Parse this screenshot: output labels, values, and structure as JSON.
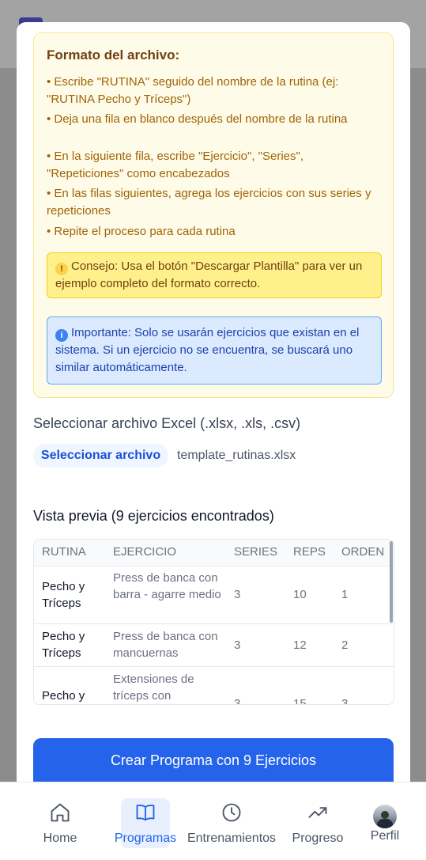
{
  "format": {
    "title": "Formato del archivo:",
    "bullets": [
      "• Escribe \"RUTINA\" seguido del nombre de la rutina (ej: \"RUTINA Pecho y Tríceps\")",
      "• Deja una fila en blanco después del nombre de la rutina",
      "• En la siguiente fila, escribe \"Ejercicio\", \"Series\", \"Repeticiones\" como encabezados",
      "• En las filas siguientes, agrega los ejercicios con sus series y repeticiones",
      "• Repite el proceso para cada rutina"
    ],
    "tip": "Consejo: Usa el botón \"Descargar Plantilla\" para ver un ejemplo completo del formato correcto.",
    "important": "Importante: Solo se usarán ejercicios que existan en el sistema. Si un ejercicio no se encuentra, se buscará uno similar automáticamente."
  },
  "file": {
    "label": "Seleccionar archivo Excel (.xlsx, .xls, .csv)",
    "button": "Seleccionar archivo",
    "filename": "template_rutinas.xlsx"
  },
  "preview": {
    "title": "Vista previa (9 ejercicios encontrados)",
    "columns": [
      "RUTINA",
      "EJERCICIO",
      "SERIES",
      "REPS",
      "ORDEN"
    ],
    "rows": [
      {
        "rutina": "Pecho y Tríceps",
        "ejercicio": "Press de banca con barra - agarre medio",
        "series": "3",
        "reps": "10",
        "orden": "1"
      },
      {
        "rutina": "Pecho y Tríceps",
        "ejercicio": "Press de banca con mancuernas",
        "series": "3",
        "reps": "12",
        "orden": "2"
      },
      {
        "rutina": "Pecho y",
        "ejercicio": "Extensiones de tríceps con",
        "series": "3",
        "reps": "15",
        "orden": "3"
      }
    ]
  },
  "create_button": "Crear Programa con 9 Ejercicios",
  "nav": {
    "items": [
      {
        "label": "Home",
        "icon": "home-icon"
      },
      {
        "label": "Programas",
        "icon": "book-icon",
        "active": true
      },
      {
        "label": "Entrenamientos",
        "icon": "clock-icon"
      },
      {
        "label": "Progreso",
        "icon": "trending-up-icon"
      },
      {
        "label": "Perfil",
        "icon": "avatar"
      }
    ]
  },
  "colors": {
    "primary": "#2563eb",
    "warning_bg": "#fefce8",
    "info_bg": "#dbeafe"
  }
}
